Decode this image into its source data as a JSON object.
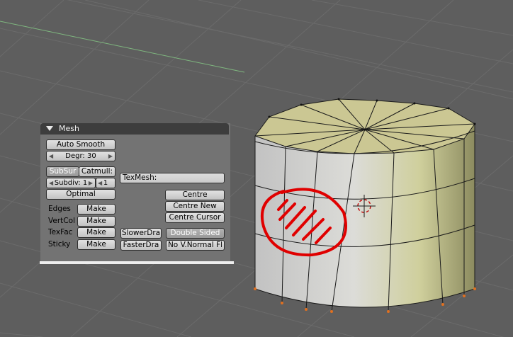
{
  "panel": {
    "title": "Mesh",
    "auto_smooth": "Auto Smooth",
    "degr": "Degr: 30",
    "subsurf": "SubSur",
    "catmull": "Catmull:",
    "subdiv": "Subdiv: 1",
    "subdiv2": "1",
    "optimal": "Optimal",
    "texmesh": "TexMesh:",
    "centre": "Centre",
    "centre_new": "Centre New",
    "centre_cursor": "Centre Cursor",
    "rows": [
      {
        "label": "Edges",
        "button": "Make"
      },
      {
        "label": "VertCol",
        "button": "Make"
      },
      {
        "label": "TexFac",
        "button": "Make"
      },
      {
        "label": "Sticky",
        "button": "Make"
      }
    ],
    "slower_draw": "SlowerDra",
    "faster_draw": "FasterDra",
    "double_sided": "Double Sided",
    "no_vnormal": "No V.Normal Fl"
  },
  "colors": {
    "background": "#5e5e5e",
    "grid": "#6a6a6a",
    "y_axis": "#7fb77f",
    "cap": "#cbc793",
    "annotation": "#e00000",
    "vertex": "#e07020"
  }
}
